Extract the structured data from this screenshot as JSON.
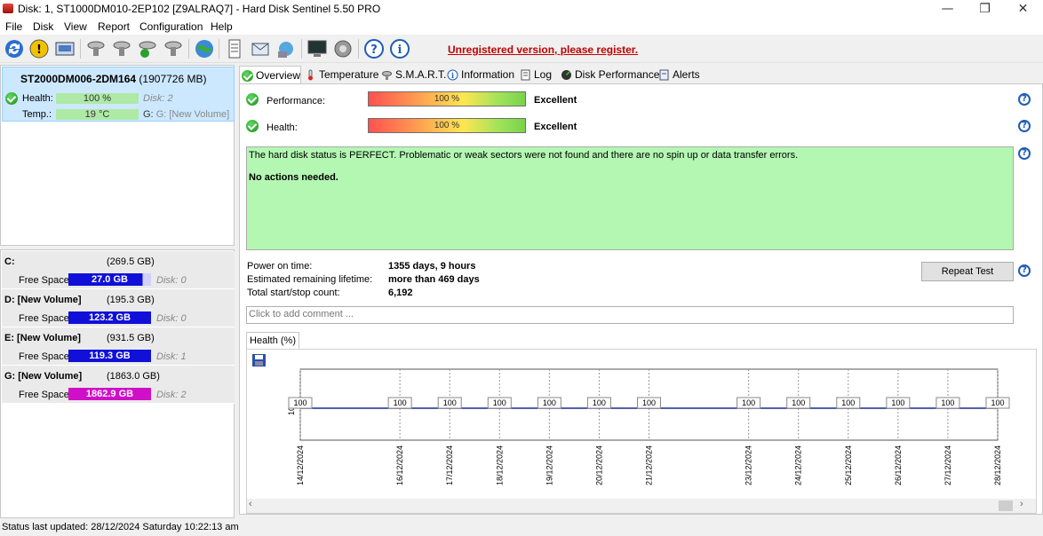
{
  "window": {
    "title": "Disk: 1, ST1000DM010-2EP102 [Z9ALRAQ7]  -  Hard Disk Sentinel 5.50 PRO",
    "minimize": "—",
    "maximize": "❐",
    "close": "✕"
  },
  "menu": [
    "File",
    "Disk",
    "View",
    "Report",
    "Configuration",
    "Help"
  ],
  "toolbar": {
    "register_link": "Unregistered version, please register."
  },
  "disk_panel": {
    "name": "ST2000DM006-2DM164",
    "size": "(1907726 MB)",
    "health_label": "Health:",
    "health_value": "100 %",
    "health_disk": "Disk: 2",
    "temp_label": "Temp.:",
    "temp_value": "19 °C",
    "temp_volume": "G: [New Volume]"
  },
  "volumes": [
    {
      "name": "C:",
      "size": "(269.5 GB)",
      "free_label": "Free Space",
      "free": "27.0 GB",
      "disk": "Disk: 0",
      "color": "#1010d8"
    },
    {
      "name": "D: [New Volume]",
      "size": "(195.3 GB)",
      "free_label": "Free Space",
      "free": "123.2 GB",
      "disk": "Disk: 0",
      "color": "#1010d8"
    },
    {
      "name": "E: [New Volume]",
      "size": "(931.5 GB)",
      "free_label": "Free Space",
      "free": "119.3 GB",
      "disk": "Disk: 1",
      "color": "#1010d8"
    },
    {
      "name": "G: [New Volume]",
      "size": "(1863.0 GB)",
      "free_label": "Free Space",
      "free": "1862.9 GB",
      "disk": "Disk: 2",
      "color": "#d010c8"
    }
  ],
  "tabs": [
    "Overview",
    "Temperature",
    "S.M.A.R.T.",
    "Information",
    "Log",
    "Disk Performance",
    "Alerts"
  ],
  "overview": {
    "performance_label": "Performance:",
    "performance_value": "100 %",
    "performance_rating": "Excellent",
    "health_label": "Health:",
    "health_value": "100 %",
    "health_rating": "Excellent",
    "status_text": "The hard disk status is PERFECT. Problematic or weak sectors were not found and there are no spin up or data transfer errors.",
    "actions_text": "No actions needed.",
    "power_on_label": "Power on time:",
    "power_on_value": "1355 days, 9 hours",
    "lifetime_label": "Estimated remaining lifetime:",
    "lifetime_value": "more than 469 days",
    "startstop_label": "Total start/stop count:",
    "startstop_value": "6,192",
    "repeat_button": "Repeat Test",
    "comment_placeholder": "Click to add comment ...",
    "health_tab": "Health (%)"
  },
  "chart_data": {
    "type": "line",
    "ylabel_tick": "100",
    "x": [
      "14/12/2024",
      "16/12/2024",
      "17/12/2024",
      "18/12/2024",
      "19/12/2024",
      "20/12/2024",
      "21/12/2024",
      "23/12/2024",
      "24/12/2024",
      "25/12/2024",
      "26/12/2024",
      "27/12/2024",
      "28/12/2024"
    ],
    "x_days": [
      0,
      2,
      3,
      4,
      5,
      6,
      7,
      9,
      10,
      11,
      12,
      13,
      14
    ],
    "values": [
      100,
      100,
      100,
      100,
      100,
      100,
      100,
      100,
      100,
      100,
      100,
      100,
      100
    ],
    "color": "#1a2a8a"
  },
  "statusbar": "Status last updated: 28/12/2024 Saturday 10:22:13 am"
}
